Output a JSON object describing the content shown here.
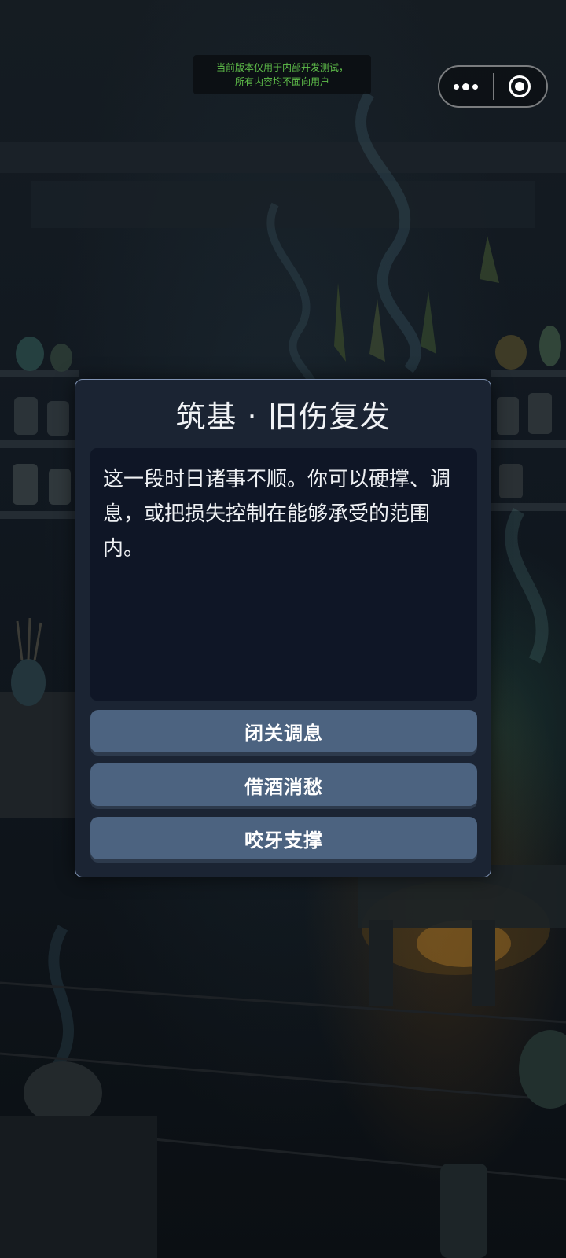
{
  "banner": {
    "line1": "当前版本仅用于内部开发测试，",
    "line2": "所有内容均不面向用户"
  },
  "capsule": {
    "more_icon": "more-dots-icon",
    "close_icon": "target-circle-icon"
  },
  "event": {
    "title": "筑基 · 旧伤复发",
    "description": "这一段时日诸事不顺。你可以硬撑、调息，或把损失控制在能够承受的范围内。",
    "choices": [
      {
        "label": "闭关调息"
      },
      {
        "label": "借酒消愁"
      },
      {
        "label": "咬牙支撑"
      }
    ]
  },
  "colors": {
    "dialog_bg": "#1b2433",
    "dialog_border": "#8093b3",
    "body_bg": "#0f1626",
    "choice_bg": "#4c6380",
    "banner_text": "#5fbf4a"
  }
}
